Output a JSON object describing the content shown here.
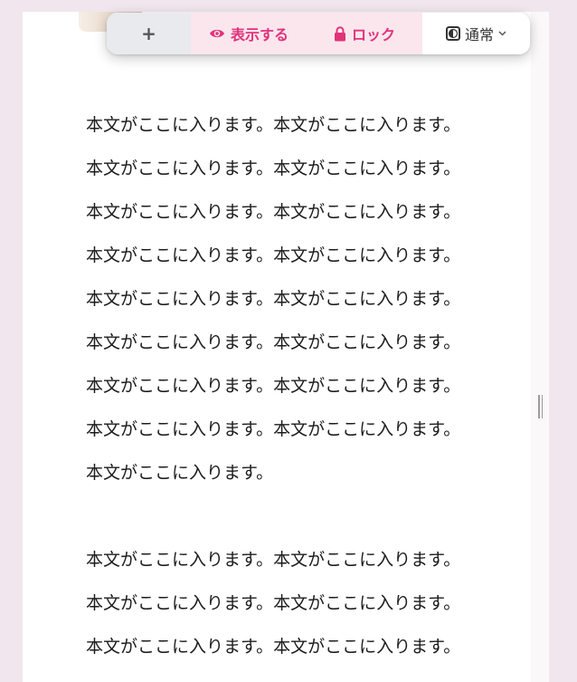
{
  "toolbar": {
    "add_label": "+",
    "show_label": "表示する",
    "lock_label": "ロック",
    "mode_label": "通常",
    "accent_color": "#e0337a"
  },
  "content": {
    "paragraphs": [
      {
        "lines": [
          "本文がここに入ります。本文がここに入ります。",
          "本文がここに入ります。本文がここに入ります。",
          "本文がここに入ります。本文がここに入ります。",
          "本文がここに入ります。本文がここに入ります。",
          "本文がここに入ります。本文がここに入ります。",
          "本文がここに入ります。本文がここに入ります。",
          "本文がここに入ります。本文がここに入ります。",
          "本文がここに入ります。本文がここに入ります。",
          "本文がここに入ります。"
        ]
      },
      {
        "lines": [
          "本文がここに入ります。本文がここに入ります。",
          "本文がここに入ります。本文がここに入ります。",
          "本文がここに入ります。本文がここに入ります。"
        ]
      }
    ]
  }
}
